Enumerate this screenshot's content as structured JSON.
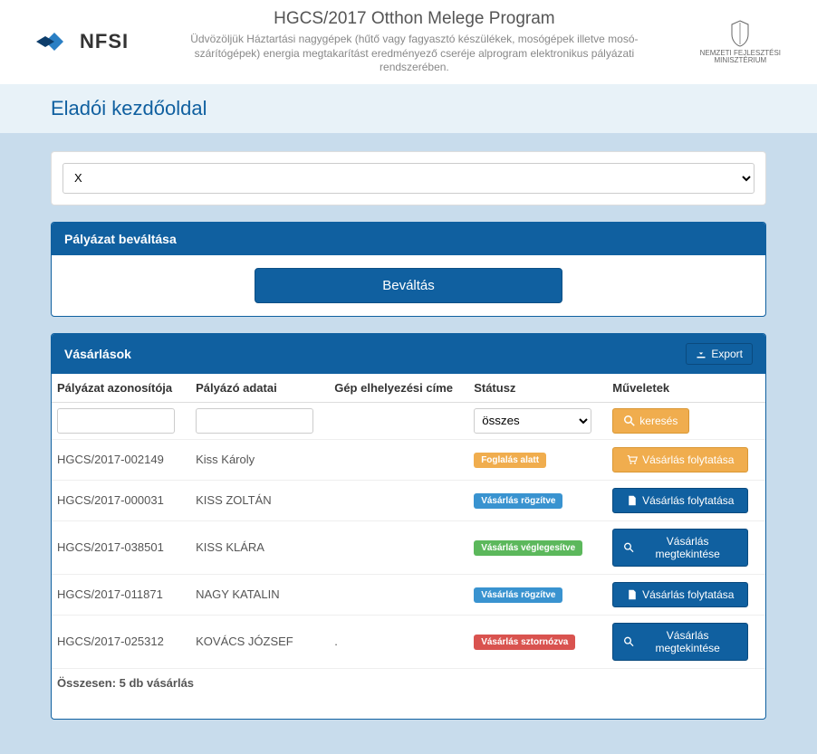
{
  "header": {
    "logo_text": "NFSI",
    "title": "HGCS/2017 Otthon Melege Program",
    "subtitle": "Üdvözöljük Háztartási nagygépek (hűtő vagy fagyasztó készülékek, mosógépek illetve mosó-szárítógépek) energia megtakarítást eredményező cseréje alprogram elektronikus pályázati rendszerében.",
    "ministry_line1": "NEMZETI FEJLESZTÉSI",
    "ministry_line2": "MINISZTÉRIUM"
  },
  "page_title": "Eladói kezdőoldal",
  "store_select": {
    "value": "X"
  },
  "redeem_panel": {
    "title": "Pályázat beváltása",
    "button": "Beváltás"
  },
  "purchases_panel": {
    "title": "Vásárlások",
    "export_label": "Export",
    "columns": {
      "id": "Pályázat azonosítója",
      "applicant": "Pályázó adatai",
      "address": "Gép elhelyezési címe",
      "status": "Státusz",
      "actions": "Műveletek"
    },
    "filters": {
      "status_all": "összes",
      "search_label": "keresés"
    },
    "rows": [
      {
        "id": "HGCS/2017-002149",
        "applicant": "Kiss Károly",
        "address": "",
        "status": "Foglalás alatt",
        "status_class": "badge-orange",
        "action": "Vásárlás folytatása",
        "action_class": "btn-orange",
        "action_icon": "cart"
      },
      {
        "id": "HGCS/2017-000031",
        "applicant": "KISS ZOLTÁN",
        "address": "",
        "status": "Vásárlás rögzítve",
        "status_class": "badge-blue",
        "action": "Vásárlás folytatása",
        "action_class": "btn-blue",
        "action_icon": "file"
      },
      {
        "id": "HGCS/2017-038501",
        "applicant": "KISS KLÁRA",
        "address": "",
        "status": "Vásárlás véglegesítve",
        "status_class": "badge-green",
        "action": "Vásárlás megtekintése",
        "action_class": "btn-blue",
        "action_icon": "search"
      },
      {
        "id": "HGCS/2017-011871",
        "applicant": "NAGY KATALIN",
        "address": "",
        "status": "Vásárlás rögzítve",
        "status_class": "badge-blue",
        "action": "Vásárlás folytatása",
        "action_class": "btn-blue",
        "action_icon": "file"
      },
      {
        "id": "HGCS/2017-025312",
        "applicant": "KOVÁCS JÓZSEF",
        "address": ".",
        "status": "Vásárlás sztornózva",
        "status_class": "badge-red",
        "action": "Vásárlás megtekintése",
        "action_class": "btn-blue",
        "action_icon": "search"
      }
    ],
    "summary": "Összesen: 5 db vásárlás"
  }
}
